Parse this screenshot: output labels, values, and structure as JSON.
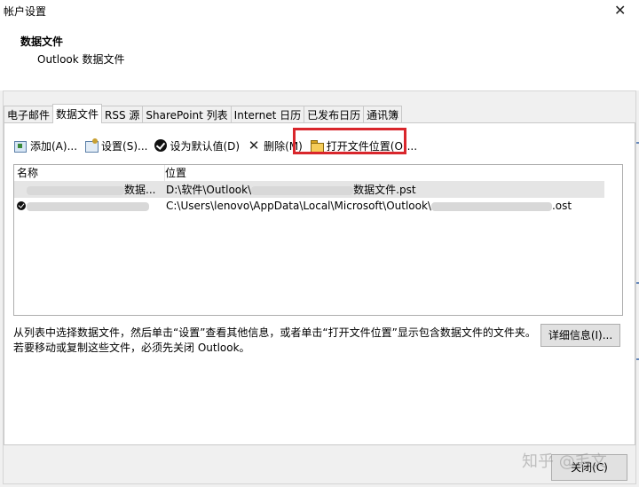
{
  "window": {
    "title": "帐户设置",
    "close_symbol": "✕"
  },
  "header": {
    "title": "数据文件",
    "subtitle": "Outlook 数据文件"
  },
  "tabs": [
    {
      "label": "电子邮件",
      "active": false
    },
    {
      "label": "数据文件",
      "active": true
    },
    {
      "label": "RSS 源",
      "active": false
    },
    {
      "label": "SharePoint 列表",
      "active": false
    },
    {
      "label": "Internet 日历",
      "active": false
    },
    {
      "label": "已发布日历",
      "active": false
    },
    {
      "label": "通讯簿",
      "active": false
    }
  ],
  "toolbar": {
    "add_label": "添加(A)...",
    "settings_label": "设置(S)...",
    "set_default_label": "设为默认值(D)",
    "remove_label": "删除(M)",
    "remove_symbol": "✕",
    "open_location_label": "打开文件位置(O)...",
    "highlight_color": "#d9262c"
  },
  "list": {
    "columns": [
      "名称",
      "位置"
    ],
    "rows": [
      {
        "name_suffix": "数据...",
        "location_prefix": "D:\\软件\\Outlook\\",
        "location_suffix": "数据文件.pst",
        "default": false,
        "selected": true
      },
      {
        "name_suffix": "",
        "location_prefix": "C:\\Users\\lenovo\\AppData\\Local\\Microsoft\\Outlook\\",
        "location_suffix": ".ost",
        "default": true,
        "selected": false
      }
    ]
  },
  "info": {
    "line1": "从列表中选择数据文件，然后单击“设置”查看其他信息，或者单击“打开文件位置”显示包含数据文件的文件夹。",
    "line2": "若要移动或复制这些文件，必须先关闭 Outlook。"
  },
  "details_button": "详细信息(I)...",
  "close_button": "关闭(C)",
  "watermark": "知乎 @毛文"
}
